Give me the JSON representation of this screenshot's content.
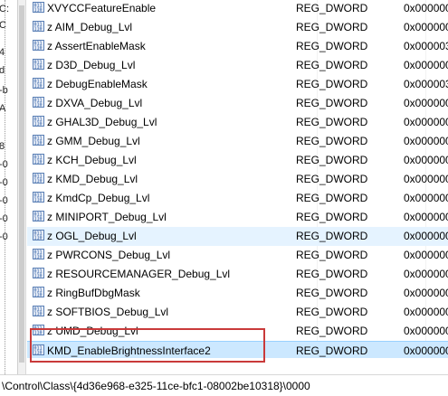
{
  "tree_fragments": [
    "C:",
    "C",
    "4",
    "d",
    "-b",
    "A",
    "8",
    "-0",
    "-0",
    "-0",
    "-0",
    "-0"
  ],
  "values": [
    {
      "name": "XVYCCFeatureEnable",
      "type": "REG_DWORD",
      "data": "0x000000"
    },
    {
      "name": "z AIM_Debug_Lvl",
      "type": "REG_DWORD",
      "data": "0x000000"
    },
    {
      "name": "z AssertEnableMask",
      "type": "REG_DWORD",
      "data": "0x000003"
    },
    {
      "name": "z D3D_Debug_Lvl",
      "type": "REG_DWORD",
      "data": "0x000000"
    },
    {
      "name": "z DebugEnableMask",
      "type": "REG_DWORD",
      "data": "0x000003"
    },
    {
      "name": "z DXVA_Debug_Lvl",
      "type": "REG_DWORD",
      "data": "0x000000"
    },
    {
      "name": "z GHAL3D_Debug_Lvl",
      "type": "REG_DWORD",
      "data": "0x000000"
    },
    {
      "name": "z GMM_Debug_Lvl",
      "type": "REG_DWORD",
      "data": "0x000000"
    },
    {
      "name": "z KCH_Debug_Lvl",
      "type": "REG_DWORD",
      "data": "0x000000"
    },
    {
      "name": "z KMD_Debug_Lvl",
      "type": "REG_DWORD",
      "data": "0x000000"
    },
    {
      "name": "z KmdCp_Debug_Lvl",
      "type": "REG_DWORD",
      "data": "0x000000"
    },
    {
      "name": "z MINIPORT_Debug_Lvl",
      "type": "REG_DWORD",
      "data": "0x000000"
    },
    {
      "name": "z OGL_Debug_Lvl",
      "type": "REG_DWORD",
      "data": "0x000000"
    },
    {
      "name": "z PWRCONS_Debug_Lvl",
      "type": "REG_DWORD",
      "data": "0x000000"
    },
    {
      "name": "z RESOURCEMANAGER_Debug_Lvl",
      "type": "REG_DWORD",
      "data": "0x000000"
    },
    {
      "name": "z RingBufDbgMask",
      "type": "REG_DWORD",
      "data": "0x000000"
    },
    {
      "name": "z SOFTBIOS_Debug_Lvl",
      "type": "REG_DWORD",
      "data": "0x000000"
    },
    {
      "name": "z UMD_Debug_Lvl",
      "type": "REG_DWORD",
      "data": "0x000000"
    },
    {
      "name": "KMD_EnableBrightnessInterface2",
      "type": "REG_DWORD",
      "data": "0x000000"
    }
  ],
  "status": {
    "path": "\\Control\\Class\\{4d36e968-e325-11ce-bfc1-08002be10318}\\0000"
  },
  "colors": {
    "hover_row": "#e5f3ff",
    "selected_row": "#cce8ff",
    "highlight_box": "#c93a3a"
  },
  "icons": {
    "value": "reg-binary-value-icon"
  }
}
